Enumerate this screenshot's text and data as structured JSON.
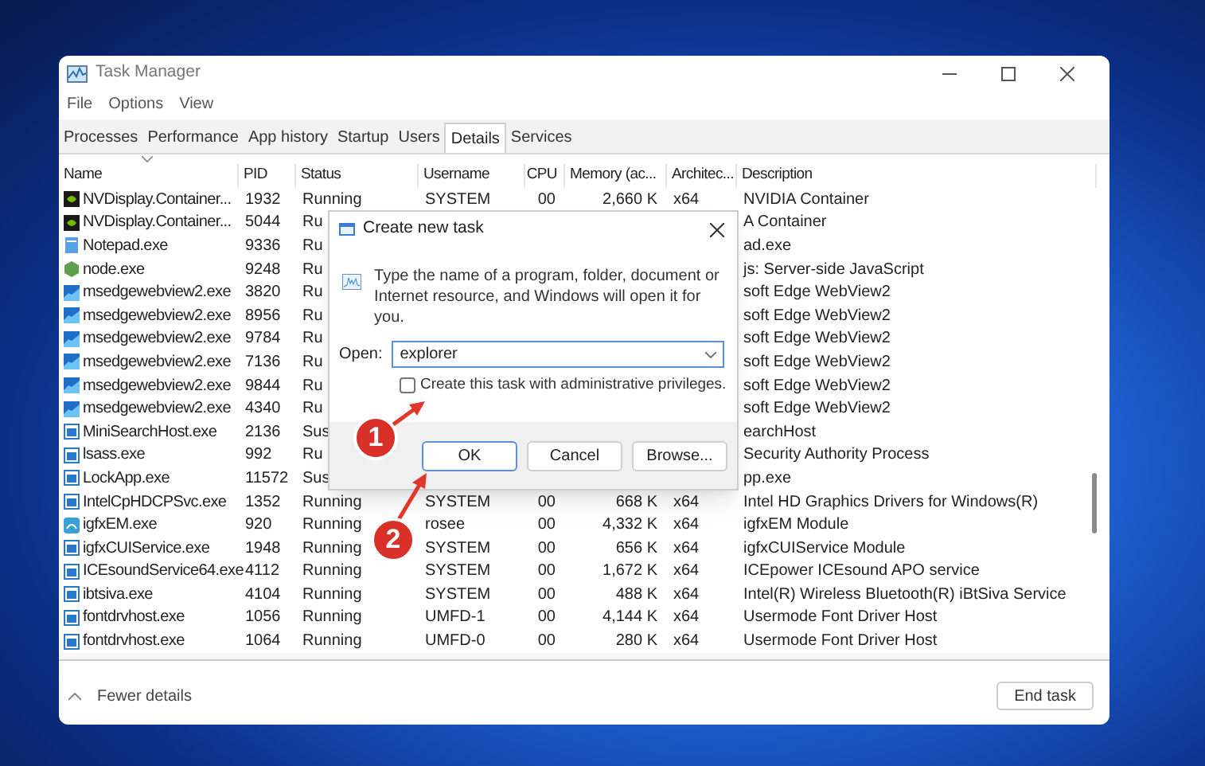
{
  "window": {
    "title": "Task Manager"
  },
  "menu": [
    "File",
    "Options",
    "View"
  ],
  "tabs": [
    {
      "label": "Processes",
      "selected": false
    },
    {
      "label": "Performance",
      "selected": false
    },
    {
      "label": "App history",
      "selected": false
    },
    {
      "label": "Startup",
      "selected": false
    },
    {
      "label": "Users",
      "selected": false
    },
    {
      "label": "Details",
      "selected": true
    },
    {
      "label": "Services",
      "selected": false
    }
  ],
  "table": {
    "columns": [
      "Name",
      "PID",
      "Status",
      "Username",
      "CPU",
      "Memory (ac...",
      "Architec...",
      "Description"
    ],
    "rows": [
      {
        "kind": "nvidia",
        "name": "NVDisplay.Container...",
        "pid": "1932",
        "status": "Running",
        "username": "SYSTEM",
        "cpu": "00",
        "memory": "2,660 K",
        "arch": "x64",
        "description": "NVIDIA Container"
      },
      {
        "kind": "nvidia",
        "name": "NVDisplay.Container...",
        "pid": "5044",
        "status": "Ru",
        "description": "A Container"
      },
      {
        "kind": "notepad",
        "name": "Notepad.exe",
        "pid": "9336",
        "status": "Ru",
        "description": "ad.exe"
      },
      {
        "kind": "node",
        "name": "node.exe",
        "pid": "9248",
        "status": "Ru",
        "description": "js: Server-side JavaScript"
      },
      {
        "kind": "webview",
        "name": "msedgewebview2.exe",
        "pid": "3820",
        "status": "Ru",
        "description": "soft Edge WebView2"
      },
      {
        "kind": "webview",
        "name": "msedgewebview2.exe",
        "pid": "8956",
        "status": "Ru",
        "description": "soft Edge WebView2"
      },
      {
        "kind": "webview",
        "name": "msedgewebview2.exe",
        "pid": "9784",
        "status": "Ru",
        "description": "soft Edge WebView2"
      },
      {
        "kind": "webview",
        "name": "msedgewebview2.exe",
        "pid": "7136",
        "status": "Ru",
        "description": "soft Edge WebView2"
      },
      {
        "kind": "webview",
        "name": "msedgewebview2.exe",
        "pid": "9844",
        "status": "Ru",
        "description": "soft Edge WebView2"
      },
      {
        "kind": "webview",
        "name": "msedgewebview2.exe",
        "pid": "4340",
        "status": "Ru",
        "description": "soft Edge WebView2"
      },
      {
        "kind": "app",
        "name": "MiniSearchHost.exe",
        "pid": "2136",
        "status": "Sus",
        "description": "earchHost"
      },
      {
        "kind": "app",
        "name": "lsass.exe",
        "pid": "992",
        "status": "Ru",
        "description": "Security Authority Process"
      },
      {
        "kind": "app",
        "name": "LockApp.exe",
        "pid": "11572",
        "status": "Sus",
        "description": "pp.exe"
      },
      {
        "kind": "app",
        "name": "IntelCpHDCPSvc.exe",
        "pid": "1352",
        "status": "Running",
        "username": "SYSTEM",
        "cpu": "00",
        "memory": "668 K",
        "arch": "x64",
        "description": "Intel HD Graphics Drivers for Windows(R)"
      },
      {
        "kind": "igfx",
        "name": "igfxEM.exe",
        "pid": "920",
        "status": "Running",
        "username": "rosee",
        "cpu": "00",
        "memory": "4,332 K",
        "arch": "x64",
        "description": "igfxEM Module"
      },
      {
        "kind": "app",
        "name": "igfxCUIService.exe",
        "pid": "1948",
        "status": "Running",
        "username": "SYSTEM",
        "cpu": "00",
        "memory": "656 K",
        "arch": "x64",
        "description": "igfxCUIService Module"
      },
      {
        "kind": "app",
        "name": "ICEsoundService64.exe",
        "pid": "4112",
        "status": "Running",
        "username": "SYSTEM",
        "cpu": "00",
        "memory": "1,672 K",
        "arch": "x64",
        "description": "ICEpower ICEsound APO service"
      },
      {
        "kind": "app",
        "name": "ibtsiva.exe",
        "pid": "4104",
        "status": "Running",
        "username": "SYSTEM",
        "cpu": "00",
        "memory": "488 K",
        "arch": "x64",
        "description": "Intel(R) Wireless Bluetooth(R) iBtSiva Service"
      },
      {
        "kind": "app",
        "name": "fontdrvhost.exe",
        "pid": "1056",
        "status": "Running",
        "username": "UMFD-1",
        "cpu": "00",
        "memory": "4,144 K",
        "arch": "x64",
        "description": "Usermode Font Driver Host"
      },
      {
        "kind": "app",
        "name": "fontdrvhost.exe",
        "pid": "1064",
        "status": "Running",
        "username": "UMFD-0",
        "cpu": "00",
        "memory": "280 K",
        "arch": "x64",
        "description": "Usermode Font Driver Host"
      }
    ]
  },
  "footer": {
    "toggle": "Fewer details",
    "button": "End task"
  },
  "dialog": {
    "title": "Create new task",
    "message": "Type the name of a program, folder, document or Internet resource, and Windows will open it for you.",
    "open_label": "Open:",
    "open_value": "explorer",
    "checkbox": {
      "label": "Create this task with administrative privileges.",
      "checked": false
    },
    "buttons": [
      "OK",
      "Cancel",
      "Browse..."
    ]
  },
  "step_markers": [
    "1",
    "2"
  ]
}
